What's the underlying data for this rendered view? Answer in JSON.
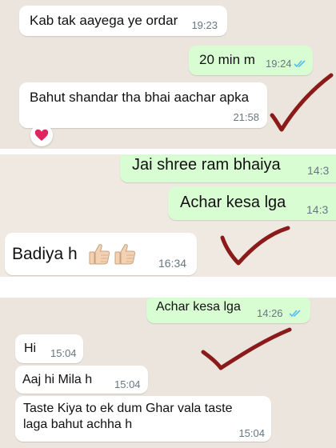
{
  "panel1": {
    "msg1": {
      "text": "Kab tak aayega ye ordar",
      "time": "19:23"
    },
    "msg2": {
      "text": "20 min m",
      "time": "19:24"
    },
    "msg3": {
      "text": "Bahut shandar tha bhai aachar apka",
      "time": "21:58"
    },
    "reaction": "heart-icon"
  },
  "panel2": {
    "msg1": {
      "text": "Jai shree ram bhaiya",
      "time": "14:3"
    },
    "msg2": {
      "text": "Achar kesa lga",
      "time": "14:3"
    },
    "msg3": {
      "text": "Badiya h",
      "time": "16:34",
      "emoji": [
        "thumbs-up-icon",
        "thumbs-up-icon"
      ]
    }
  },
  "panel3": {
    "msg1": {
      "text": "Achar kesa lga",
      "time": "14:26"
    },
    "msg2": {
      "text": "Hi",
      "time": "15:04"
    },
    "msg3": {
      "text": "Aaj hi Mila h",
      "time": "15:04"
    },
    "msg4": {
      "text_line1": "Taste Kiya to ek dum Ghar vala taste",
      "text_line2": "laga bahut achha h",
      "time": "15:04"
    }
  },
  "colors": {
    "incoming": "#ffffff",
    "outgoing": "#d9fdd3",
    "read_ticks": "#53bdeb",
    "annotation": "#8b1a1a"
  }
}
